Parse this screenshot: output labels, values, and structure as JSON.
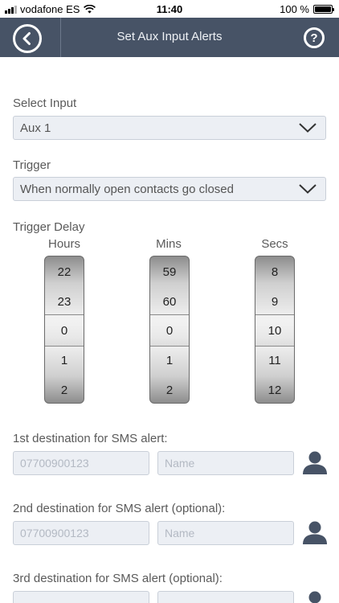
{
  "status_bar": {
    "carrier": "vodafone ES",
    "time": "11:40",
    "battery_percent": "100 %",
    "battery_level": 1.0
  },
  "header": {
    "title": "Set Aux Input Alerts",
    "back_icon": "back-arrow-icon",
    "help_icon": "help-icon"
  },
  "select_input": {
    "label": "Select Input",
    "value": "Aux 1"
  },
  "trigger": {
    "label": "When normally open contacts go closed",
    "title": "Trigger"
  },
  "trigger_delay": {
    "label": "Trigger Delay",
    "hours": {
      "title": "Hours",
      "values": [
        "22",
        "23",
        "0",
        "1",
        "2"
      ]
    },
    "mins": {
      "title": "Mins",
      "values": [
        "59",
        "60",
        "0",
        "1",
        "2"
      ]
    },
    "secs": {
      "title": "Secs",
      "values": [
        "8",
        "9",
        "10",
        "11",
        "12"
      ]
    }
  },
  "sms": [
    {
      "label": "1st destination for SMS alert:",
      "phone_placeholder": "07700900123",
      "name_placeholder": "Name"
    },
    {
      "label": "2nd destination for SMS alert (optional):",
      "phone_placeholder": "07700900123",
      "name_placeholder": "Name"
    },
    {
      "label": "3rd destination for SMS alert (optional):",
      "phone_placeholder": "",
      "name_placeholder": ""
    }
  ],
  "colors": {
    "header_bg": "#475366",
    "field_bg": "#eceff4",
    "icon": "#475366"
  }
}
